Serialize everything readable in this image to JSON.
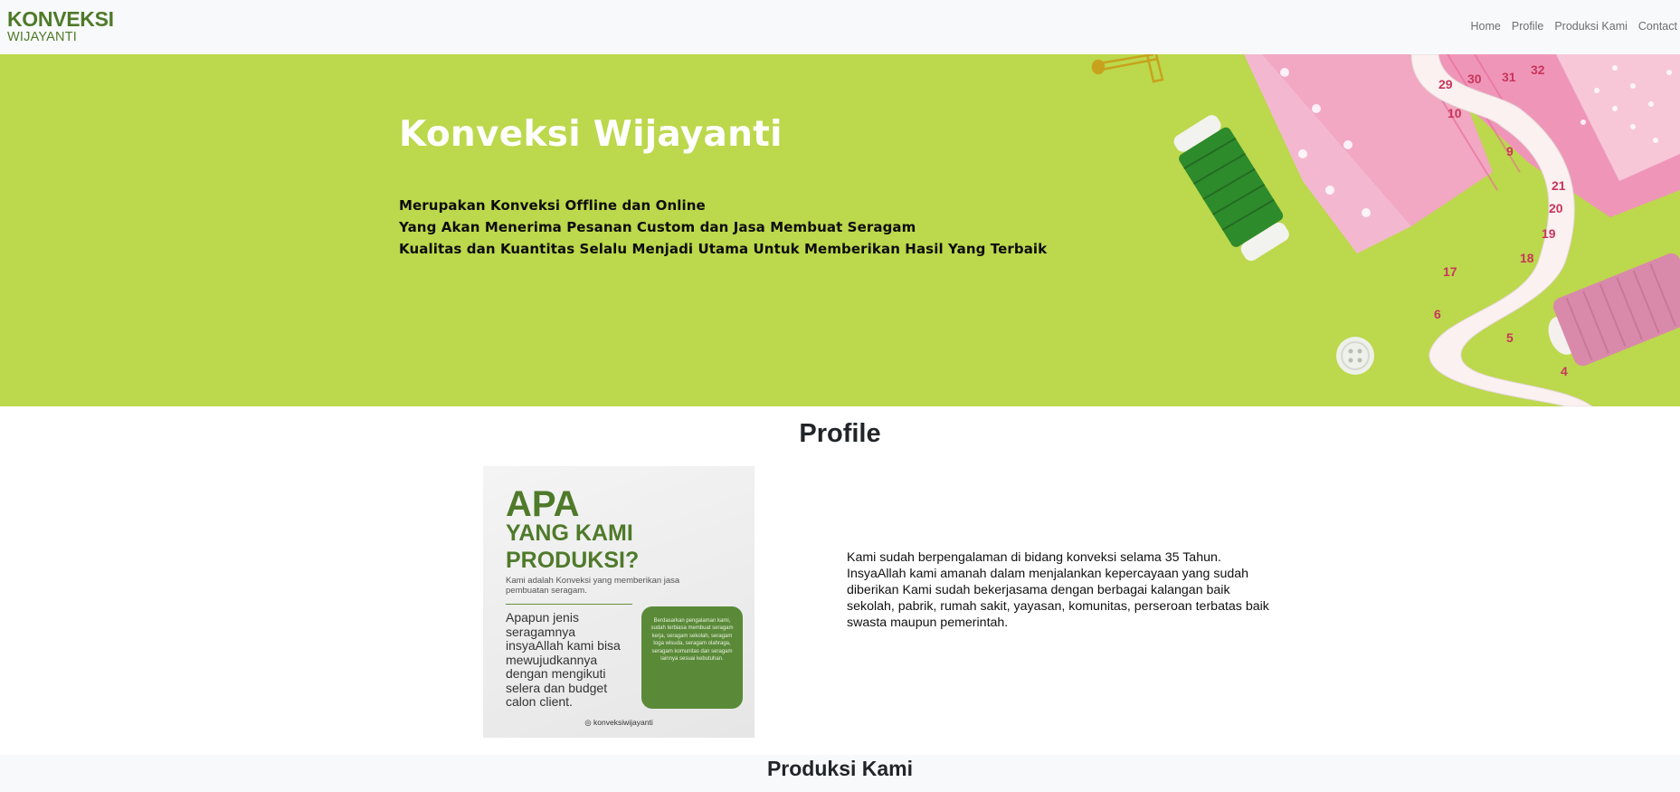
{
  "brand": {
    "line1": "KONVEKSI",
    "line2": "WIJAYANTI"
  },
  "nav": {
    "items": [
      "Home",
      "Profile",
      "Produksi Kami",
      "Contact"
    ]
  },
  "hero": {
    "title": "Konveksi Wijayanti",
    "lines": [
      "Merupakan Konveksi Offline dan Online",
      "Yang Akan Menerima Pesanan Custom dan Jasa Membuat Seragam",
      "Kualitas dan Kuantitas Selalu Menjadi Utama Untuk Memberikan Hasil Yang Terbaik"
    ],
    "background_color": "#bcd84c",
    "tape_numbers": [
      "29",
      "30",
      "31",
      "32",
      "10",
      "9",
      "21",
      "20",
      "19",
      "18",
      "17",
      "6",
      "5",
      "4"
    ]
  },
  "profile": {
    "title": "Profile",
    "description": "Kami sudah berpengalaman di bidang konveksi selama 35 Tahun. InsyaAllah kami amanah dalam menjalankan kepercayaan yang sudah diberikan Kami sudah bekerjasama dengan berbagai kalangan baik sekolah, pabrik, rumah sakit, yayasan, komunitas, perseroan terbatas baik swasta maupun pemerintah.",
    "poster": {
      "headline1": "APA",
      "headline2": "YANG KAMI PRODUKSI?",
      "subtitle": "Kami adalah Konveksi yang memberikan jasa pembuatan seragam.",
      "body": "Apapun jenis seragamnya insyaAllah kami bisa mewujudkannya dengan mengikuti selera dan budget calon client.",
      "box_text": "Berdasarkan pengalaman kami, sudah terbiasa membuat seragam kerja, seragam sekolah, seragam toga wisuda, seragam olahraga, seragam komunitas dan seragam lainnya sesuai kebutuhan.",
      "handle": "◎ konveksiwijayanti"
    }
  },
  "produksi": {
    "title": "Produksi Kami"
  },
  "colors": {
    "brand_green": "#4f7a2a",
    "navbar_bg": "#f8f9fa"
  }
}
